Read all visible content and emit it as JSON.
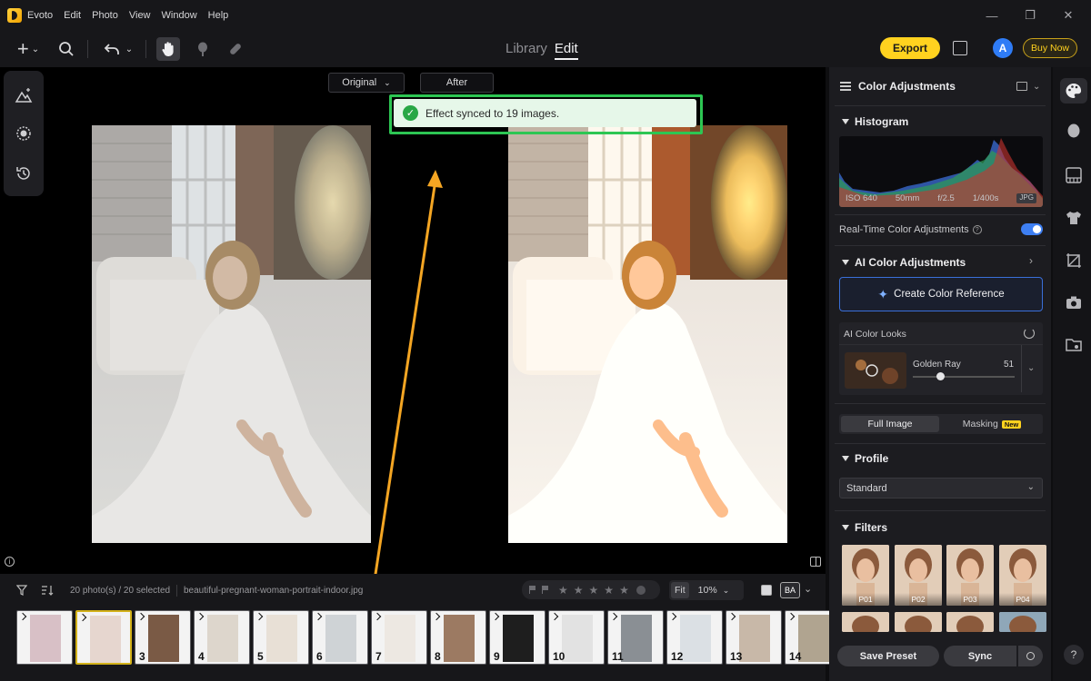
{
  "menubar": {
    "app_name": "Evoto",
    "items": [
      "Edit",
      "Photo",
      "View",
      "Window",
      "Help"
    ]
  },
  "toolbar": {
    "tabs": {
      "library": "Library",
      "edit": "Edit"
    },
    "export_label": "Export",
    "avatar_letter": "A",
    "buy_now_label": "Buy Now"
  },
  "canvas": {
    "original_label": "Original",
    "after_label": "After",
    "toast_message": "Effect synced to 19 images."
  },
  "filmstrip": {
    "count_text": "20 photo(s) / 20 selected",
    "filename": "beautiful-pregnant-woman-portrait-indoor.jpg",
    "fit_label": "Fit",
    "zoom_value": "10%",
    "ba_label": "BA",
    "thumbnails": [
      {
        "num": "",
        "selected": false
      },
      {
        "num": "",
        "selected": true
      },
      {
        "num": "3",
        "selected": false
      },
      {
        "num": "4",
        "selected": false
      },
      {
        "num": "5",
        "selected": false
      },
      {
        "num": "6",
        "selected": false
      },
      {
        "num": "7",
        "selected": false
      },
      {
        "num": "8",
        "selected": false
      },
      {
        "num": "9",
        "selected": false
      },
      {
        "num": "10",
        "selected": false
      },
      {
        "num": "11",
        "selected": false
      },
      {
        "num": "12",
        "selected": false
      },
      {
        "num": "13",
        "selected": false
      },
      {
        "num": "14",
        "selected": false
      }
    ]
  },
  "panel": {
    "title": "Color Adjustments",
    "histogram_title": "Histogram",
    "exif": {
      "iso": "ISO 640",
      "focal": "50mm",
      "aperture": "f/2.5",
      "shutter": "1/400s",
      "format": "JPG"
    },
    "realtime_label": "Real-Time Color Adjustments",
    "realtime_enabled": true,
    "ai_color_title": "AI Color Adjustments",
    "create_ref_label": "Create Color Reference",
    "looks_title": "AI Color Looks",
    "look_name": "Golden Ray",
    "look_value": "51",
    "look_level": 0.51,
    "full_image_label": "Full Image",
    "masking_label": "Masking",
    "new_badge": "New",
    "profile_title": "Profile",
    "profile_value": "Standard",
    "filters_title": "Filters",
    "filters": [
      "P01",
      "P02",
      "P03",
      "P04"
    ],
    "save_preset_label": "Save Preset",
    "sync_label": "Sync"
  },
  "colors": {
    "accent_yellow": "#ffd21f",
    "toast_green": "#2dc653",
    "toggle_blue": "#3e7ff2",
    "arrow_orange": "#f5a623"
  }
}
